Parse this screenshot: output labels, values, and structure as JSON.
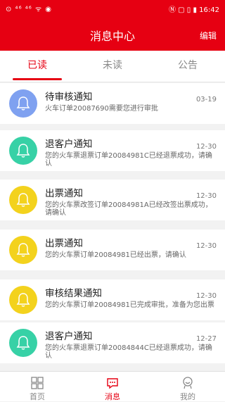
{
  "status_bar": {
    "left": "⊙ ⁴⁶ ⁴⁶ ᯤ ◉",
    "right": "Ⓝ ▢ ▯ ▮ 16:42"
  },
  "header": {
    "title": "消息中心",
    "edit": "编辑"
  },
  "tabs": [
    {
      "label": "已读",
      "active": true
    },
    {
      "label": "未读",
      "active": false
    },
    {
      "label": "公告",
      "active": false
    }
  ],
  "messages": [
    {
      "title": "待审核通知",
      "date": "03-19",
      "text": "火车订单20087690需要您进行审批",
      "icon": "bell-icon",
      "color": "#7fa1f0"
    },
    {
      "title": "退客户通知",
      "date": "12-30",
      "text": "您的火车票退票订单20084981C已经退票成功，请确认",
      "icon": "bell-icon",
      "color": "#37d1a6"
    },
    {
      "title": "出票通知",
      "date": "12-30",
      "text": "您的火车票改签订单20084981A已经改签出票成功，请确认",
      "icon": "bell-icon",
      "color": "#f3d21d"
    },
    {
      "title": "出票通知",
      "date": "12-30",
      "text": "您的火车票订单20084981已经出票，请确认",
      "icon": "bell-icon",
      "color": "#f3d21d"
    },
    {
      "title": "审核结果通知",
      "date": "12-30",
      "text": "您的火车票订单20084981已完成审批，准备为您出票",
      "icon": "bell-icon",
      "color": "#f3d21d"
    },
    {
      "title": "退客户通知",
      "date": "12-27",
      "text": "您的火车票退票订单20084844C已经退票成功，请确认",
      "icon": "bell-icon",
      "color": "#37d1a6"
    }
  ],
  "bottom_nav": [
    {
      "label": "首页",
      "icon": "grid-icon",
      "active": false
    },
    {
      "label": "消息",
      "icon": "message-icon",
      "active": true
    },
    {
      "label": "我的",
      "icon": "user-icon",
      "active": false
    }
  ],
  "colors": {
    "brand": "#e60012"
  }
}
